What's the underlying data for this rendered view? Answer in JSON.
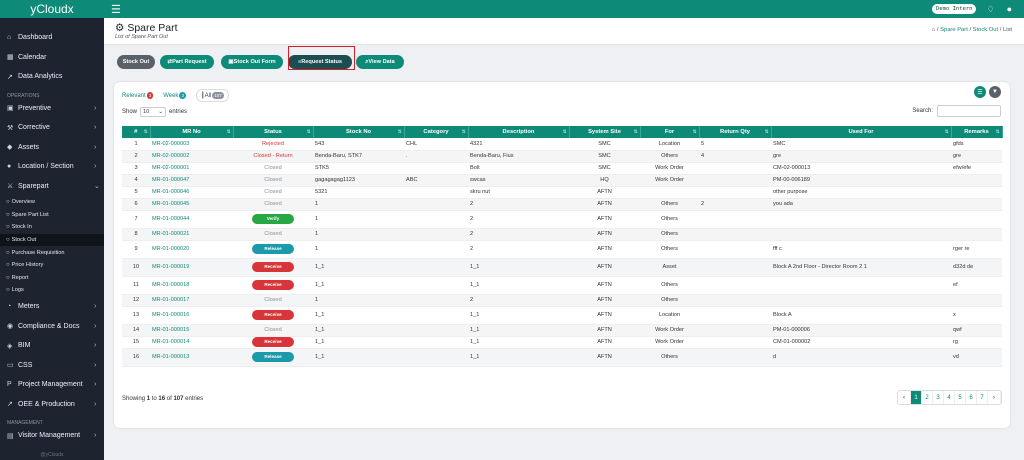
{
  "brand": "yCloudx",
  "topbar": {
    "user": "Demo Intern"
  },
  "nav": {
    "main": [
      {
        "icon": "home-icon",
        "glyph": "⌂",
        "label": "Dashboard",
        "caret": false
      },
      {
        "icon": "calendar-icon",
        "glyph": "▦",
        "label": "Calendar",
        "caret": false
      },
      {
        "icon": "chart-icon",
        "glyph": "↗",
        "label": "Data Analytics",
        "caret": false
      }
    ],
    "operations_label": "OPERATIONS",
    "ops": [
      {
        "icon": "calendar-check-icon",
        "glyph": "▣",
        "label": "Preventive",
        "caret": true
      },
      {
        "icon": "wrench-icon",
        "glyph": "⚒",
        "label": "Corrective",
        "caret": true
      },
      {
        "icon": "tag-icon",
        "glyph": "◆",
        "label": "Assets",
        "caret": true
      },
      {
        "icon": "location-icon",
        "glyph": "●",
        "label": "Location / Section",
        "caret": true
      },
      {
        "icon": "sparepart-icon",
        "glyph": "⚔",
        "label": "Sparepart",
        "caret": true
      }
    ],
    "sub": [
      "Overview",
      "Spare Part List",
      "Stock In",
      "Stock Out",
      "Purchase Requisition",
      "Price History",
      "Report",
      "Logs"
    ],
    "sub_active": 3,
    "ops2": [
      {
        "icon": "meter-icon",
        "glyph": "◔",
        "label": "Meters",
        "caret": true
      },
      {
        "icon": "compliance-icon",
        "glyph": "◉",
        "label": "Compliance & Docs",
        "caret": true
      },
      {
        "icon": "bim-icon",
        "glyph": "◈",
        "label": "BIM",
        "caret": true
      },
      {
        "icon": "monitor-icon",
        "glyph": "▭",
        "label": "CSS",
        "caret": true
      },
      {
        "icon": "project-icon",
        "glyph": "P",
        "label": "Project Management",
        "caret": true
      },
      {
        "icon": "oee-icon",
        "glyph": "↗",
        "label": "OEE & Production",
        "caret": true
      }
    ],
    "management_label": "MANAGEMENT",
    "mgmt": [
      {
        "icon": "visitor-icon",
        "glyph": "▤",
        "label": "Visitor Management",
        "caret": true
      }
    ],
    "footer": "@yCloudx"
  },
  "page": {
    "title": "Spare Part",
    "subtitle": "List of Spare Part Out"
  },
  "breadcrumb": {
    "items": [
      "Spare Part",
      "Stock Out",
      "List"
    ]
  },
  "toolbar": [
    {
      "label": "Stock Out",
      "style": "grey",
      "glyph": ""
    },
    {
      "label": "Part Request",
      "style": "green",
      "glyph": "⇄ "
    },
    {
      "label": "Stock Out Form",
      "style": "green",
      "glyph": "▣ "
    },
    {
      "label": "Request Status",
      "style": "dark",
      "glyph": "≡ "
    },
    {
      "label": "View Data",
      "style": "green",
      "glyph": "⌕ "
    }
  ],
  "tabs": [
    {
      "label": "Relevant",
      "count": "3",
      "color": "b-red"
    },
    {
      "label": "Week",
      "count": "3",
      "color": "b-teal"
    },
    {
      "label": "All",
      "count": "107",
      "color": "b-grey"
    }
  ],
  "list": {
    "show_label": "Show",
    "entries_value": "10",
    "entries_label": "entries",
    "search_label": "Search:"
  },
  "columns": [
    "#",
    "MR No",
    "Status",
    "Stock No",
    "Category",
    "Description",
    "System Site",
    "For",
    "Return Qty",
    "Used For",
    "Remarks"
  ],
  "rows": [
    {
      "n": "1",
      "mr": "MR-02-000003",
      "status": "Rejected",
      "type": "text-rej",
      "stock": "543",
      "cat": "CHL",
      "desc": "4321",
      "site": "SMC",
      "for": "Location",
      "rq": "5",
      "used": "SMC",
      "rem": "gfds"
    },
    {
      "n": "2",
      "mr": "MR-02-000002",
      "status": "Closed - Return",
      "type": "text-rej",
      "stock": "Benda-Baru, STK7",
      "cat": ".",
      "desc": "Benda-Baru, Fius",
      "site": "SMC",
      "for": "Others",
      "rq": "4",
      "used": "gre",
      "rem": "gre"
    },
    {
      "n": "3",
      "mr": "MR-02-000001",
      "status": "Closed",
      "type": "text-cl",
      "stock": "STK5",
      "cat": "",
      "desc": "Bolt",
      "site": "SMC",
      "for": "Work Order",
      "rq": "",
      "used": "CM-02-000013",
      "rem": "efw/efe"
    },
    {
      "n": "4",
      "mr": "MR-01-000047",
      "status": "Closed",
      "type": "text-cl",
      "stock": "gagagagag1123",
      "cat": "ABC",
      "desc": "swcas",
      "site": "HQ",
      "for": "Work Order",
      "rq": "",
      "used": "PM-00-006189",
      "rem": ""
    },
    {
      "n": "5",
      "mr": "MR-01-000046",
      "status": "Closed",
      "type": "text-cl",
      "stock": "5321",
      "cat": "",
      "desc": "skru nut",
      "site": "AFTN",
      "for": "",
      "rq": "",
      "used": "other purpose",
      "rem": ""
    },
    {
      "n": "6",
      "mr": "MR-01-000045",
      "status": "Closed",
      "type": "text-cl",
      "stock": "1",
      "cat": "",
      "desc": "2",
      "site": "AFTN",
      "for": "Others",
      "rq": "2",
      "used": "you ada",
      "rem": ""
    },
    {
      "n": "7",
      "mr": "MR-01-000044",
      "status": "Verify",
      "type": "p-verify",
      "stock": "1",
      "cat": "",
      "desc": "2",
      "site": "AFTN",
      "for": "Others",
      "rq": "",
      "used": "",
      "rem": ""
    },
    {
      "n": "8",
      "mr": "MR-01-000021",
      "status": "Closed",
      "type": "text-cl",
      "stock": "1",
      "cat": "",
      "desc": "2",
      "site": "AFTN",
      "for": "Others",
      "rq": "",
      "used": "",
      "rem": ""
    },
    {
      "n": "9",
      "mr": "MR-01-000020",
      "status": "Release",
      "type": "p-release",
      "stock": "1",
      "cat": "",
      "desc": "2",
      "site": "AFTN",
      "for": "Others",
      "rq": "",
      "used": "fff c",
      "rem": "rger re"
    },
    {
      "n": "10",
      "mr": "MR-01-000019",
      "status": "Receive",
      "type": "p-receive",
      "stock": "1_1",
      "cat": "",
      "desc": "1_1",
      "site": "AFTN",
      "for": "Asset",
      "rq": "",
      "used": "Block A 2nd Floor - Director Room 2 1",
      "rem": "d32d de"
    },
    {
      "n": "11",
      "mr": "MR-01-000018",
      "status": "Receive",
      "type": "p-receive",
      "stock": "1_1",
      "cat": "",
      "desc": "1_1",
      "site": "AFTN",
      "for": "Others",
      "rq": "",
      "used": "",
      "rem": "ef"
    },
    {
      "n": "12",
      "mr": "MR-01-000017",
      "status": "Closed",
      "type": "text-cl",
      "stock": "1",
      "cat": "",
      "desc": "2",
      "site": "AFTN",
      "for": "Others",
      "rq": "",
      "used": "",
      "rem": ""
    },
    {
      "n": "13",
      "mr": "MR-01-000016",
      "status": "Receive",
      "type": "p-receive",
      "stock": "1_1",
      "cat": "",
      "desc": "1_1",
      "site": "AFTN",
      "for": "Location",
      "rq": "",
      "used": "Block A",
      "rem": "x"
    },
    {
      "n": "14",
      "mr": "MR-01-000015",
      "status": "Closed",
      "type": "text-cl",
      "stock": "1_1",
      "cat": "",
      "desc": "1_1",
      "site": "AFTN",
      "for": "Work Order",
      "rq": "",
      "used": "PM-01-000006",
      "rem": "qwf"
    },
    {
      "n": "15",
      "mr": "MR-01-000014",
      "status": "Receive",
      "type": "p-receive",
      "stock": "1_1",
      "cat": "",
      "desc": "1_1",
      "site": "AFTN",
      "for": "Work Order",
      "rq": "",
      "used": "CM-01-000002",
      "rem": "rg"
    },
    {
      "n": "16",
      "mr": "MR-01-000013",
      "status": "Release",
      "type": "p-release",
      "stock": "1_1",
      "cat": "",
      "desc": "1_1",
      "site": "AFTN",
      "for": "Others",
      "rq": "",
      "used": "d",
      "rem": "vd"
    }
  ],
  "info": {
    "prefix": "Showing",
    "from": "1",
    "to_label": "to",
    "to": "16",
    "of_label": "of",
    "total": "107",
    "suffix": "entries"
  },
  "pager": {
    "prev": "‹",
    "next": "›",
    "pages": [
      "1",
      "2",
      "3",
      "4",
      "5",
      "6",
      "7"
    ],
    "active": 0
  }
}
